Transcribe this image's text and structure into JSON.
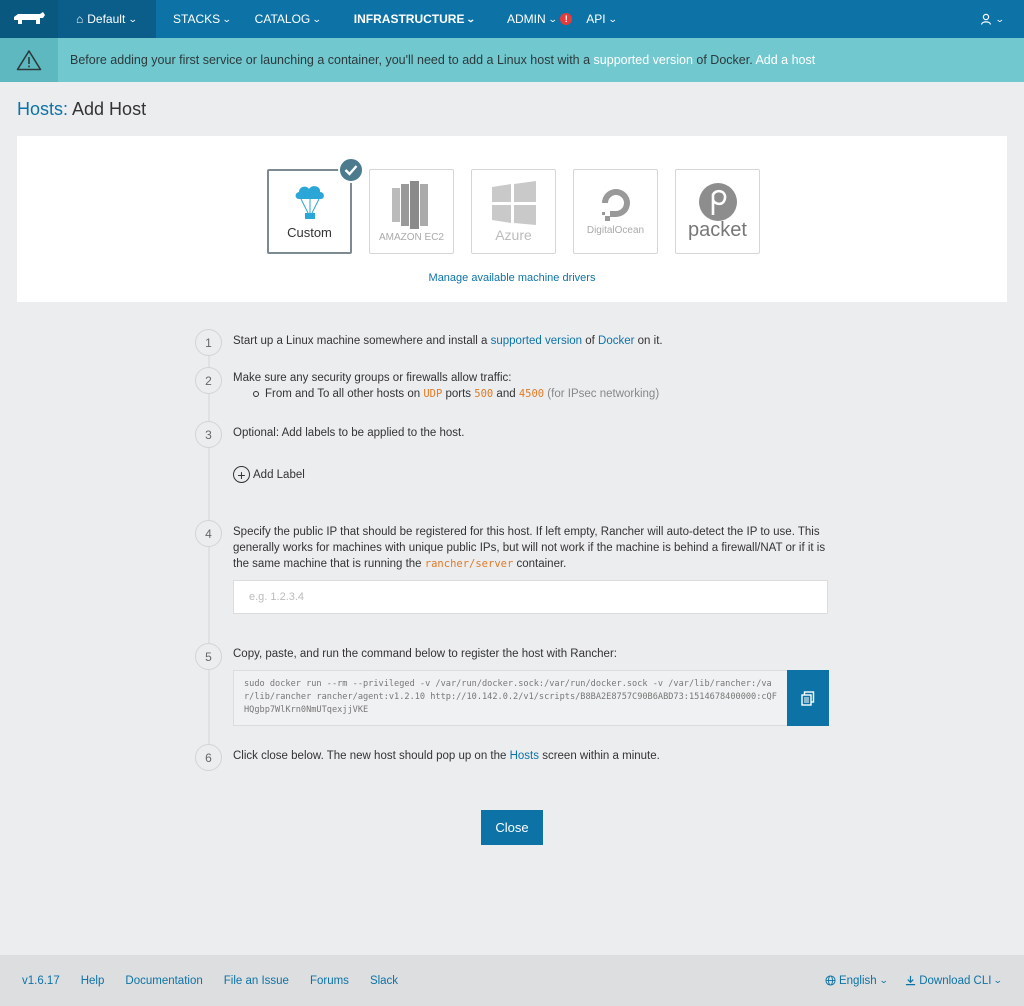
{
  "nav": {
    "environment": "Default",
    "items": [
      {
        "label": "STACKS"
      },
      {
        "label": "CATALOG"
      },
      {
        "label": "INFRASTRUCTURE"
      },
      {
        "label": "ADMIN"
      },
      {
        "label": "API"
      }
    ],
    "admin_alert": "!"
  },
  "banner": {
    "text_before": "Before adding your first service or launching a container, you'll need to add a Linux host with a ",
    "link1": "supported version",
    "text_middle": " of Docker. ",
    "link2": "Add a host"
  },
  "page": {
    "crumb": "Hosts:",
    "title": "Add Host"
  },
  "drivers": {
    "items": [
      {
        "label": "Custom",
        "selected": true
      },
      {
        "label": "AMAZON EC2"
      },
      {
        "label": "Azure"
      },
      {
        "label": "DigitalOcean"
      },
      {
        "label": "packet"
      }
    ],
    "manage_link": "Manage available machine drivers"
  },
  "steps": {
    "s1": {
      "num": "1",
      "a": "Start up a Linux machine somewhere and install a ",
      "link1": "supported version",
      "b": " of ",
      "link2": "Docker",
      "c": " on it."
    },
    "s2": {
      "num": "2",
      "text": "Make sure any security groups or firewalls allow traffic:",
      "b1": "From and To all other hosts on ",
      "proto": "UDP",
      "b2": " ports ",
      "port1": "500",
      "b3": " and ",
      "port2": "4500",
      "note": " (for IPsec networking)"
    },
    "s3": {
      "num": "3",
      "text": "Optional: Add labels to be applied to the host.",
      "add_label": "Add Label"
    },
    "s4": {
      "num": "4",
      "a": "Specify the public IP that should be registered for this host. If left empty, Rancher will auto-detect the IP to use. This generally works for machines with unique public IPs, but will not work if the machine is behind a firewall/NAT or if it is the same machine that is running the ",
      "code": "rancher/server",
      "b": " container.",
      "placeholder": "e.g. 1.2.3.4"
    },
    "s5": {
      "num": "5",
      "text": "Copy, paste, and run the command below to register the host with Rancher:",
      "command": "sudo docker run --rm --privileged -v /var/run/docker.sock:/var/run/docker.sock -v /var/lib/rancher:/var/lib/rancher rancher/agent:v1.2.10 http://10.142.0.2/v1/scripts/B8BA2E8757C90B6ABD73:1514678400000:cQFHQgbp7WlKrn0NmUTqexjjVKE"
    },
    "s6": {
      "num": "6",
      "a": "Click close below. The new host should pop up on the ",
      "link": "Hosts",
      "b": " screen within a minute."
    }
  },
  "close_label": "Close",
  "footer": {
    "version": "v1.6.17",
    "links": [
      "Help",
      "Documentation",
      "File an Issue",
      "Forums",
      "Slack"
    ],
    "language": "English",
    "download": "Download CLI"
  },
  "colors": {
    "primary": "#0d73a6",
    "banner": "#72c8cf",
    "accent_code": "#e07b26"
  }
}
